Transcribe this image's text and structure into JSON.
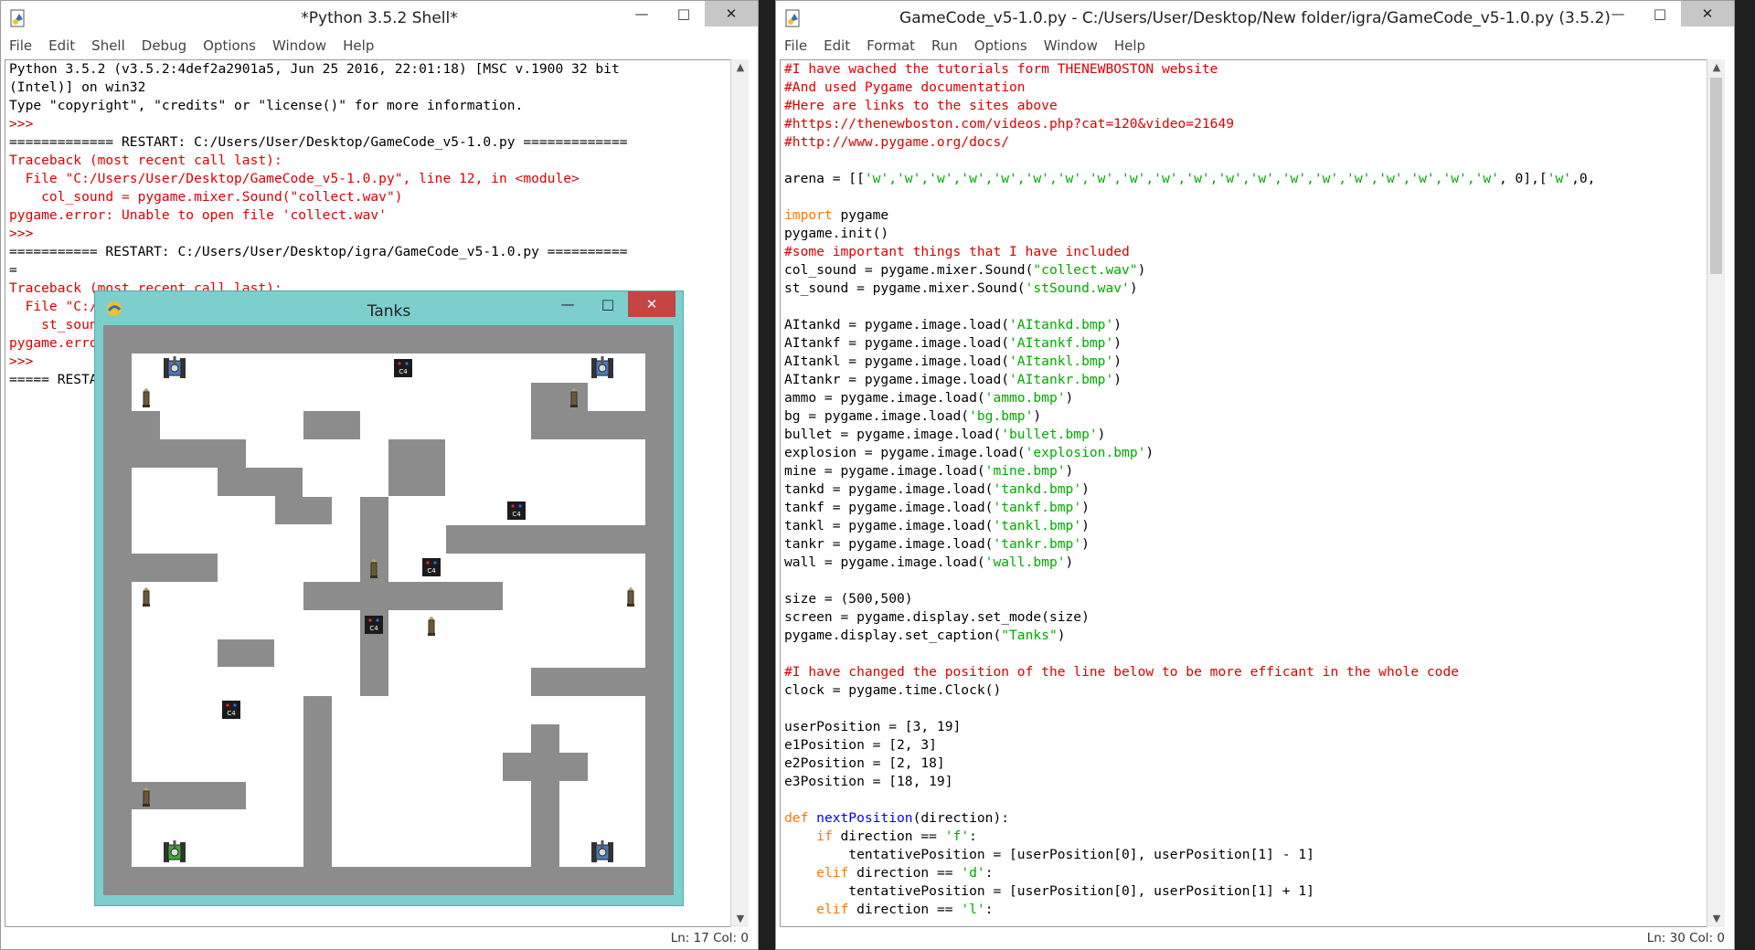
{
  "shell": {
    "title": "*Python 3.5.2 Shell*",
    "menu": [
      "File",
      "Edit",
      "Shell",
      "Debug",
      "Options",
      "Window",
      "Help"
    ],
    "lines": [
      {
        "text": "Python 3.5.2 (v3.5.2:4def2a2901a5, Jun 25 2016, 22:01:18) [MSC v.1900 32 bit",
        "cls": "c-def"
      },
      {
        "text": "(Intel)] on win32",
        "cls": "c-def"
      },
      {
        "text": "Type \"copyright\", \"credits\" or \"license()\" for more information.",
        "cls": "c-def"
      },
      {
        "text": ">>> ",
        "cls": "c-prompt"
      },
      {
        "text": "============= RESTART: C:/Users/User/Desktop/GameCode_v5-1.0.py =============",
        "cls": "c-def"
      },
      {
        "text": "Traceback (most recent call last):",
        "cls": "c-red"
      },
      {
        "text": "  File \"C:/Users/User/Desktop/GameCode_v5-1.0.py\", line 12, in <module>",
        "cls": "c-red"
      },
      {
        "text": "    col_sound = pygame.mixer.Sound(\"collect.wav\")",
        "cls": "c-red"
      },
      {
        "text": "pygame.error: Unable to open file 'collect.wav'",
        "cls": "c-red"
      },
      {
        "text": ">>> ",
        "cls": "c-prompt"
      },
      {
        "text": "=========== RESTART: C:/Users/User/Desktop/igra/GameCode_v5-1.0.py ==========",
        "cls": "c-def"
      },
      {
        "text": "=",
        "cls": "c-def"
      },
      {
        "text": "Traceback (most recent call last):",
        "cls": "c-red"
      },
      {
        "text": "  File \"C:/Users/User/Desktop/igra/GameCode_v5-1.0.py\", line 12, in <module>",
        "cls": "c-red"
      },
      {
        "text": "    st_sound = pygame.mixer.Sound('stSound.wav')",
        "cls": "c-red"
      },
      {
        "text": "pygame.error: Unable to open file 'stSound.wav'",
        "cls": "c-red"
      },
      {
        "text": ">>> ",
        "cls": "c-prompt"
      },
      {
        "text": "===== RESTART: C:/Users/User/Desktop/New folder/igra/GameCode_v5-1.0.py =====",
        "cls": "c-def"
      }
    ],
    "status": "Ln: 17  Col: 0"
  },
  "editor": {
    "title": "GameCode_v5-1.0.py - C:/Users/User/Desktop/New folder/igra/GameCode_v5-1.0.py (3.5.2)",
    "menu": [
      "File",
      "Edit",
      "Format",
      "Run",
      "Options",
      "Window",
      "Help"
    ],
    "lines": [
      [
        {
          "t": "#I have wached the tutorials form THENEWBOSTON website",
          "c": "c-red"
        }
      ],
      [
        {
          "t": "#And used Pygame documentation",
          "c": "c-red"
        }
      ],
      [
        {
          "t": "#Here are links to the sites above",
          "c": "c-red"
        }
      ],
      [
        {
          "t": "#https://thenewboston.com/videos.php?cat=120&video=21649",
          "c": "c-red"
        }
      ],
      [
        {
          "t": "#http://www.pygame.org/docs/",
          "c": "c-red"
        }
      ],
      [
        {
          "t": "",
          "c": "c-def"
        }
      ],
      [
        {
          "t": "arena = [[",
          "c": "c-def"
        },
        {
          "t": "'w','w','w','w','w','w','w','w','w','w','w','w','w','w','w','w','w','w','w','w'",
          "c": "c-str"
        },
        {
          "t": ", 0],[",
          "c": "c-def"
        },
        {
          "t": "'w'",
          "c": "c-str"
        },
        {
          "t": ",0,",
          "c": "c-def"
        }
      ],
      [
        {
          "t": "",
          "c": "c-def"
        }
      ],
      [
        {
          "t": "import",
          "c": "c-kw"
        },
        {
          "t": " pygame",
          "c": "c-def"
        }
      ],
      [
        {
          "t": "pygame.init()",
          "c": "c-def"
        }
      ],
      [
        {
          "t": "#some important things that I have included",
          "c": "c-red"
        }
      ],
      [
        {
          "t": "col_sound = pygame.mixer.Sound(",
          "c": "c-def"
        },
        {
          "t": "\"collect.wav\"",
          "c": "c-str"
        },
        {
          "t": ")",
          "c": "c-def"
        }
      ],
      [
        {
          "t": "st_sound = pygame.mixer.Sound(",
          "c": "c-def"
        },
        {
          "t": "'stSound.wav'",
          "c": "c-str"
        },
        {
          "t": ")",
          "c": "c-def"
        }
      ],
      [
        {
          "t": "",
          "c": "c-def"
        }
      ],
      [
        {
          "t": "AItankd = pygame.image.load(",
          "c": "c-def"
        },
        {
          "t": "'AItankd.bmp'",
          "c": "c-str"
        },
        {
          "t": ")",
          "c": "c-def"
        }
      ],
      [
        {
          "t": "AItankf = pygame.image.load(",
          "c": "c-def"
        },
        {
          "t": "'AItankf.bmp'",
          "c": "c-str"
        },
        {
          "t": ")",
          "c": "c-def"
        }
      ],
      [
        {
          "t": "AItankl = pygame.image.load(",
          "c": "c-def"
        },
        {
          "t": "'AItankl.bmp'",
          "c": "c-str"
        },
        {
          "t": ")",
          "c": "c-def"
        }
      ],
      [
        {
          "t": "AItankr = pygame.image.load(",
          "c": "c-def"
        },
        {
          "t": "'AItankr.bmp'",
          "c": "c-str"
        },
        {
          "t": ")",
          "c": "c-def"
        }
      ],
      [
        {
          "t": "ammo = pygame.image.load(",
          "c": "c-def"
        },
        {
          "t": "'ammo.bmp'",
          "c": "c-str"
        },
        {
          "t": ")",
          "c": "c-def"
        }
      ],
      [
        {
          "t": "bg = pygame.image.load(",
          "c": "c-def"
        },
        {
          "t": "'bg.bmp'",
          "c": "c-str"
        },
        {
          "t": ")",
          "c": "c-def"
        }
      ],
      [
        {
          "t": "bullet = pygame.image.load(",
          "c": "c-def"
        },
        {
          "t": "'bullet.bmp'",
          "c": "c-str"
        },
        {
          "t": ")",
          "c": "c-def"
        }
      ],
      [
        {
          "t": "explosion = pygame.image.load(",
          "c": "c-def"
        },
        {
          "t": "'explosion.bmp'",
          "c": "c-str"
        },
        {
          "t": ")",
          "c": "c-def"
        }
      ],
      [
        {
          "t": "mine = pygame.image.load(",
          "c": "c-def"
        },
        {
          "t": "'mine.bmp'",
          "c": "c-str"
        },
        {
          "t": ")",
          "c": "c-def"
        }
      ],
      [
        {
          "t": "tankd = pygame.image.load(",
          "c": "c-def"
        },
        {
          "t": "'tankd.bmp'",
          "c": "c-str"
        },
        {
          "t": ")",
          "c": "c-def"
        }
      ],
      [
        {
          "t": "tankf = pygame.image.load(",
          "c": "c-def"
        },
        {
          "t": "'tankf.bmp'",
          "c": "c-str"
        },
        {
          "t": ")",
          "c": "c-def"
        }
      ],
      [
        {
          "t": "tankl = pygame.image.load(",
          "c": "c-def"
        },
        {
          "t": "'tankl.bmp'",
          "c": "c-str"
        },
        {
          "t": ")",
          "c": "c-def"
        }
      ],
      [
        {
          "t": "tankr = pygame.image.load(",
          "c": "c-def"
        },
        {
          "t": "'tankr.bmp'",
          "c": "c-str"
        },
        {
          "t": ")",
          "c": "c-def"
        }
      ],
      [
        {
          "t": "wall = pygame.image.load(",
          "c": "c-def"
        },
        {
          "t": "'wall.bmp'",
          "c": "c-str"
        },
        {
          "t": ")",
          "c": "c-def"
        }
      ],
      [
        {
          "t": "",
          "c": "c-def"
        }
      ],
      [
        {
          "t": "size = (500,500)",
          "c": "c-def"
        }
      ],
      [
        {
          "t": "screen = pygame.display.set_mode(size)",
          "c": "c-def"
        }
      ],
      [
        {
          "t": "pygame.display.set_caption(",
          "c": "c-def"
        },
        {
          "t": "\"Tanks\"",
          "c": "c-str"
        },
        {
          "t": ")",
          "c": "c-def"
        }
      ],
      [
        {
          "t": "",
          "c": "c-def"
        }
      ],
      [
        {
          "t": "#I have changed the position of the line below to be more efficant in the whole code",
          "c": "c-red"
        }
      ],
      [
        {
          "t": "clock = pygame.time.Clock()",
          "c": "c-def"
        }
      ],
      [
        {
          "t": "",
          "c": "c-def"
        }
      ],
      [
        {
          "t": "userPosition = [3, 19]",
          "c": "c-def"
        }
      ],
      [
        {
          "t": "e1Position = [2, 3]",
          "c": "c-def"
        }
      ],
      [
        {
          "t": "e2Position = [2, 18]",
          "c": "c-def"
        }
      ],
      [
        {
          "t": "e3Position = [18, 19]",
          "c": "c-def"
        }
      ],
      [
        {
          "t": "",
          "c": "c-def"
        }
      ],
      [
        {
          "t": "def",
          "c": "c-kw"
        },
        {
          "t": " ",
          "c": "c-def"
        },
        {
          "t": "nextPosition",
          "c": "c-fn"
        },
        {
          "t": "(direction):",
          "c": "c-def"
        }
      ],
      [
        {
          "t": "    ",
          "c": "c-def"
        },
        {
          "t": "if",
          "c": "c-kw"
        },
        {
          "t": " direction == ",
          "c": "c-def"
        },
        {
          "t": "'f'",
          "c": "c-str"
        },
        {
          "t": ":",
          "c": "c-def"
        }
      ],
      [
        {
          "t": "        tentativePosition = [userPosition[0], userPosition[1] - 1]",
          "c": "c-def"
        }
      ],
      [
        {
          "t": "    ",
          "c": "c-def"
        },
        {
          "t": "elif",
          "c": "c-kw"
        },
        {
          "t": " direction == ",
          "c": "c-def"
        },
        {
          "t": "'d'",
          "c": "c-str"
        },
        {
          "t": ":",
          "c": "c-def"
        }
      ],
      [
        {
          "t": "        tentativePosition = [userPosition[0], userPosition[1] + 1]",
          "c": "c-def"
        }
      ],
      [
        {
          "t": "    ",
          "c": "c-def"
        },
        {
          "t": "elif",
          "c": "c-kw"
        },
        {
          "t": " direction == ",
          "c": "c-def"
        },
        {
          "t": "'l'",
          "c": "c-str"
        },
        {
          "t": ":",
          "c": "c-def"
        }
      ]
    ],
    "status": "Ln: 30  Col: 0"
  },
  "tanks": {
    "title": "Tanks",
    "grid_rows": [
      "wwwwwwwwwwwwwwwwwwww",
      "w..................w",
      "w..............ww..w",
      "ww.....ww......wwwww",
      "wwwww.....ww.......w",
      "w...www...ww.......w",
      "w.....ww.w.........w",
      "w........w..wwwwwwww",
      "wwww.....w.........w",
      "w......wwwwwww.....w",
      "w........w.........w",
      "w...ww...w.........w",
      "w........w.....wwwww",
      "w......w...........w",
      "w......w.......w...w",
      "w......w......www..w",
      "wwwww..w.......w...w",
      "w......w.......w...w",
      "w......w.......w...w",
      "wwwwwwwwwwwwwwwwwwww"
    ],
    "sprites": [
      {
        "kind": "ai-tank",
        "col": 2,
        "row": 1
      },
      {
        "kind": "ai-tank",
        "col": 17,
        "row": 1
      },
      {
        "kind": "ai-tank",
        "col": 17,
        "row": 18
      },
      {
        "kind": "player-tank",
        "col": 2,
        "row": 18
      },
      {
        "kind": "mine",
        "col": 10,
        "row": 1
      },
      {
        "kind": "mine",
        "col": 14,
        "row": 6
      },
      {
        "kind": "mine",
        "col": 11,
        "row": 8
      },
      {
        "kind": "mine",
        "col": 9,
        "row": 10
      },
      {
        "kind": "mine",
        "col": 4,
        "row": 13
      },
      {
        "kind": "ammo",
        "col": 1,
        "row": 2
      },
      {
        "kind": "ammo",
        "col": 16,
        "row": 2
      },
      {
        "kind": "ammo",
        "col": 9,
        "row": 8
      },
      {
        "kind": "ammo",
        "col": 1,
        "row": 9
      },
      {
        "kind": "ammo",
        "col": 18,
        "row": 9
      },
      {
        "kind": "ammo",
        "col": 11,
        "row": 10
      },
      {
        "kind": "ammo",
        "col": 1,
        "row": 16
      }
    ],
    "mine_label": "C4"
  },
  "colors": {
    "wall": "#8c8c8c",
    "floor": "#ffffff",
    "tanks_frame": "#7dcfce",
    "ai_tank": "#4a7ab8",
    "player_tank": "#3aa83a"
  }
}
